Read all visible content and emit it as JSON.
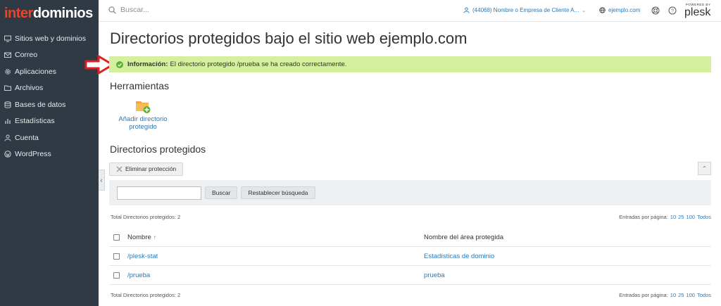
{
  "brand": {
    "part1": "inter",
    "part2": "dominios",
    "color1": "#e8462c",
    "color2": "#ffffff"
  },
  "colors": {
    "sidebar": "#2f3a45",
    "link": "#2a78b5",
    "success_bg": "#d4ef9d",
    "success_icon": "#5cb02f",
    "arrow": "#e02020"
  },
  "sidebar": {
    "items": [
      {
        "label": "Sitios web y dominios",
        "icon": "monitor-icon"
      },
      {
        "label": "Correo",
        "icon": "mail-icon"
      },
      {
        "label": "Aplicaciones",
        "icon": "gear-icon"
      },
      {
        "label": "Archivos",
        "icon": "folder-icon"
      },
      {
        "label": "Bases de datos",
        "icon": "database-icon"
      },
      {
        "label": "Estadísticas",
        "icon": "bar-chart-icon"
      },
      {
        "label": "Cuenta",
        "icon": "account-icon"
      },
      {
        "label": "WordPress",
        "icon": "wordpress-icon"
      }
    ]
  },
  "header": {
    "search_placeholder": "Buscar...",
    "account": "(44068) Nombre o Empresa de Cliente A...",
    "domain": "ejemplo.com",
    "powered_by": "POWERED BY",
    "plesk": "plesk"
  },
  "main": {
    "title": "Directorios protegidos bajo el sitio web ejemplo.com",
    "info_label": "Información:",
    "info_text": "El directorio protegido /prueba se ha creado correctamente.",
    "tools_heading": "Herramientas",
    "tool_add_label": "Añadir directorio protegido",
    "list_heading": "Directorios protegidos",
    "remove_button": "Eliminar protección",
    "search_button": "Buscar",
    "reset_button": "Restablecer búsqueda",
    "total_text": "Total Directorios protegidos: 2",
    "per_page_label": "Entradas por página:",
    "per_page_options": [
      "10",
      "25",
      "100",
      "Todos"
    ],
    "columns": {
      "name": "Nombre",
      "sort_indicator": "↑",
      "area": "Nombre del área protegida"
    },
    "rows": [
      {
        "name": "/plesk-stat",
        "area": "Estadísticas de dominio"
      },
      {
        "name": "/prueba",
        "area": "prueba"
      }
    ]
  }
}
